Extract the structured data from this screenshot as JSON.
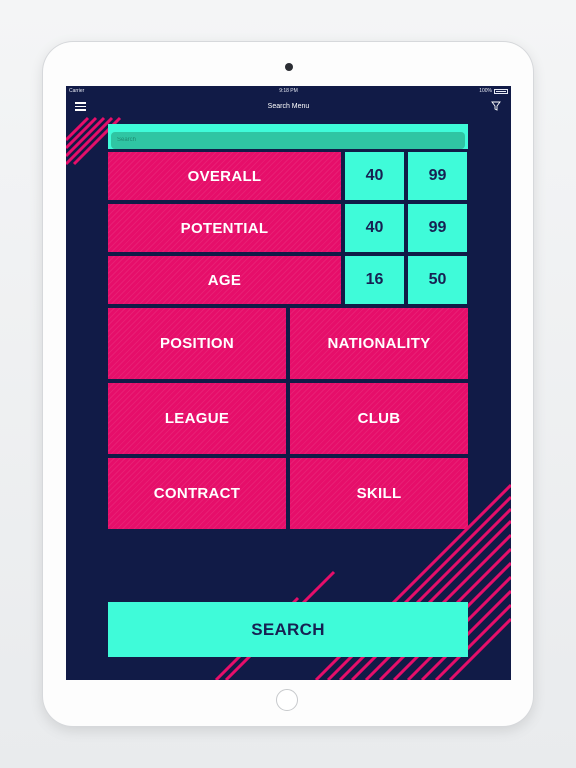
{
  "status": {
    "carrier": "Carrier",
    "time": "9:18 PM",
    "battery": "100%"
  },
  "nav": {
    "title": "Search Menu",
    "menu_icon": "hamburger-menu-icon",
    "filter_icon": "filter-funnel-icon"
  },
  "search": {
    "placeholder": "Search",
    "value": ""
  },
  "ranges": [
    {
      "label": "OVERALL",
      "min": "40",
      "max": "99"
    },
    {
      "label": "POTENTIAL",
      "min": "40",
      "max": "99"
    },
    {
      "label": "AGE",
      "min": "16",
      "max": "50"
    }
  ],
  "filters": [
    "POSITION",
    "NATIONALITY",
    "LEAGUE",
    "CLUB",
    "CONTRACT",
    "SKILL"
  ],
  "search_button": "SEARCH",
  "colors": {
    "background": "#111b47",
    "pink": "#e60e6a",
    "cyan": "#3ffbd9",
    "text_dark": "#172052"
  }
}
